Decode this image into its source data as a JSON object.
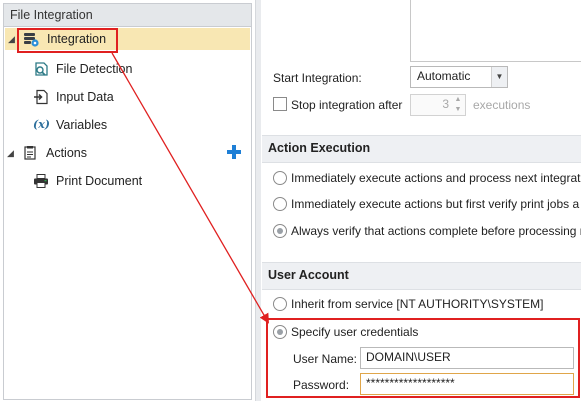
{
  "tree": {
    "header": "File Integration",
    "items": [
      {
        "label": "Integration",
        "icon": "integration-icon",
        "selected": true
      },
      {
        "label": "File Detection",
        "icon": "file-detection-icon"
      },
      {
        "label": "Input Data",
        "icon": "input-data-icon"
      },
      {
        "label": "Variables",
        "icon": "variables-icon"
      },
      {
        "label": "Actions",
        "icon": "actions-icon"
      },
      {
        "label": "Print Document",
        "icon": "printer-icon"
      }
    ],
    "add_icon": "plus-icon",
    "add_color": "#1e7fd6"
  },
  "integration": {
    "start_label": "Start Integration:",
    "start_value": "Automatic",
    "stop_label": "Stop integration after",
    "stop_value": "3",
    "stop_unit": "executions"
  },
  "action_execution": {
    "heading": "Action Execution",
    "options": [
      "Immediately execute actions and process next integrati",
      "Immediately execute actions but first verify print jobs a",
      "Always verify that actions complete before processing n"
    ],
    "selected_index": 2
  },
  "user_account": {
    "heading": "User Account",
    "options": [
      "Inherit from service [NT AUTHORITY\\SYSTEM]",
      "Specify user credentials"
    ],
    "selected_index": 1,
    "username_label": "User Name:",
    "username_value": "DOMAIN\\USER",
    "password_label": "Password:",
    "password_value": "*******************"
  },
  "colors": {
    "annotation": "#e02020",
    "selection": "#f8e7b3"
  }
}
